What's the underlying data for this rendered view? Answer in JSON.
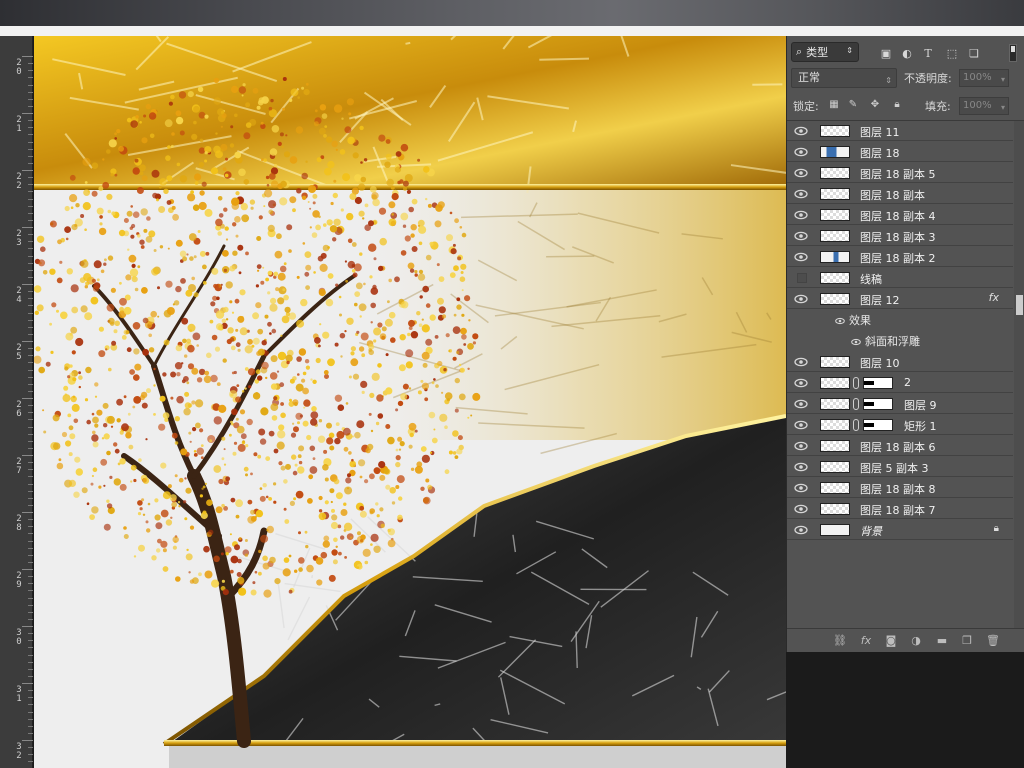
{
  "panel": {
    "kind_filter": "类型",
    "blend_mode": "正常",
    "opacity_label": "不透明度:",
    "opacity_value": "100%",
    "lock_label": "锁定:",
    "fill_label": "填充:",
    "fill_value": "100%",
    "layers": [
      {
        "name": "图层 11",
        "visible": true,
        "thumb": "transparent"
      },
      {
        "name": "图层 18",
        "visible": true,
        "thumb": "blue"
      },
      {
        "name": "图层 18 副本 5",
        "visible": true,
        "thumb": "transparent"
      },
      {
        "name": "图层 18 副本",
        "visible": true,
        "thumb": "transparent"
      },
      {
        "name": "图层 18 副本 4",
        "visible": true,
        "thumb": "transparent"
      },
      {
        "name": "图层 18 副本 3",
        "visible": true,
        "thumb": "transparent"
      },
      {
        "name": "图层 18 副本 2",
        "visible": true,
        "thumb": "blue2"
      },
      {
        "name": "线稿",
        "visible": false,
        "thumb": "transparent"
      },
      {
        "name": "图层 12",
        "visible": true,
        "thumb": "transparent",
        "fx": "fx"
      },
      {
        "name": "效果",
        "effect_header": true
      },
      {
        "name": "斜面和浮雕",
        "effect_item": true
      },
      {
        "name": "图层 10",
        "visible": true,
        "thumb": "transparent"
      },
      {
        "name": "2",
        "visible": true,
        "thumb": "transparent",
        "masked": true
      },
      {
        "name": "图层 9",
        "visible": true,
        "thumb": "transparent",
        "masked": true
      },
      {
        "name": "矩形 1",
        "visible": true,
        "thumb": "transparent",
        "masked": true
      },
      {
        "name": "图层 18 副本 6",
        "visible": true,
        "thumb": "transparent"
      },
      {
        "name": "图层 5 副本 3",
        "visible": true,
        "thumb": "transparent"
      },
      {
        "name": "图层 18 副本 8",
        "visible": true,
        "thumb": "transparent"
      },
      {
        "name": "图层 18 副本 7",
        "visible": true,
        "thumb": "transparent"
      },
      {
        "name": "背景",
        "visible": true,
        "thumb": "solid",
        "locked": true,
        "italic": true
      }
    ],
    "footer_icons": [
      "link-icon",
      "fx-icon",
      "mask-icon",
      "adjustment-icon",
      "folder-icon",
      "new-layer-icon",
      "trash-icon"
    ]
  },
  "ruler": {
    "labels": [
      "20",
      "21",
      "22",
      "23",
      "24",
      "25",
      "26",
      "27",
      "28",
      "29",
      "30",
      "31",
      "32"
    ]
  },
  "canvas": {
    "accent_gold": "#e0a812",
    "accent_red": "#a8300c",
    "rock_dark": "#2a2a2a"
  }
}
